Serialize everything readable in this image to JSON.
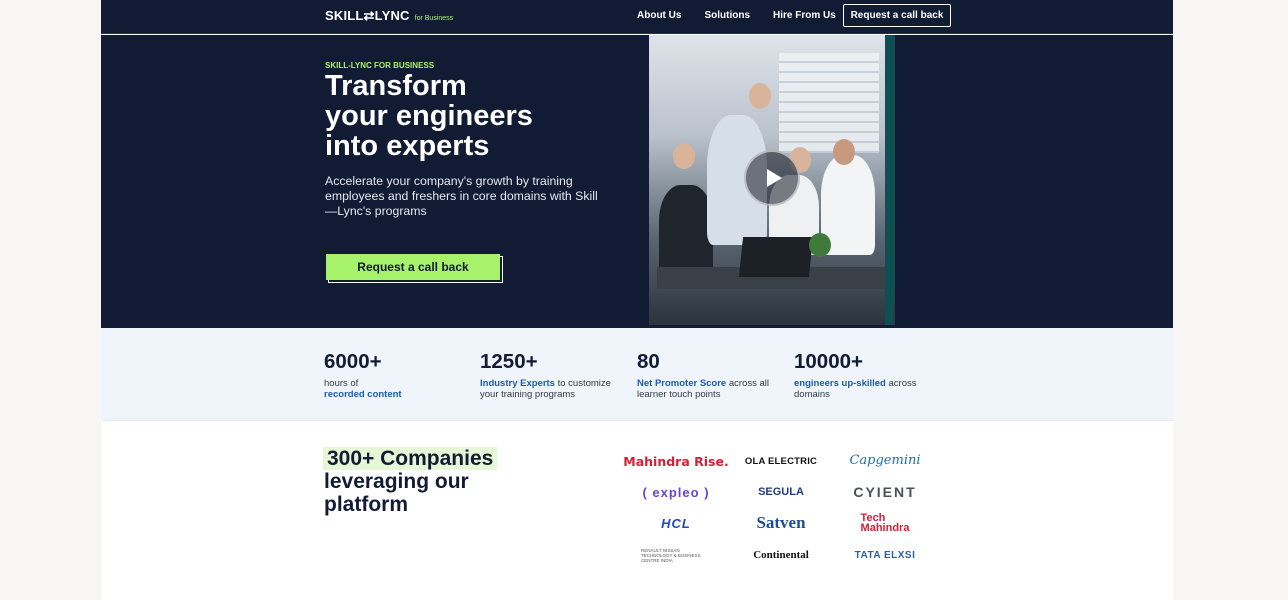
{
  "nav": {
    "logo": "SKILL⇄LYNC",
    "logo_sub": "for Business",
    "links": [
      "About Us",
      "Solutions",
      "Hire From Us"
    ],
    "cta": "Request a call back"
  },
  "hero": {
    "eyebrow": "SKILL-LYNC FOR BUSINESS",
    "headline_lines": [
      "Transform",
      "your engineers",
      "into experts"
    ],
    "subtext": "Accelerate your company's growth by training employees and freshers in core domains with Skill—Lync's programs",
    "cta": "Request a call back",
    "video": {
      "icon": "play-icon"
    }
  },
  "stats": [
    {
      "number": "6000+",
      "pre": "hours of ",
      "highlight": "recorded content",
      "post": ""
    },
    {
      "number": "1250+",
      "pre": "",
      "highlight": "Industry Experts",
      "post": " to customize your training programs"
    },
    {
      "number": "80",
      "pre": "",
      "highlight": "Net Promoter Score",
      "post": " across all learner touch points"
    },
    {
      "number": "10000+",
      "pre": "",
      "highlight": "engineers up-skilled",
      "post": " across domains"
    }
  ],
  "companies": {
    "title_chip": "300+ Companies",
    "title_rest": [
      "leveraging our",
      "platform"
    ],
    "logos": [
      "Mahindra Rise.",
      "OLA ELECTRIC",
      "Capgemini",
      "( expleo )",
      "SEGULA",
      "CYIENT",
      "HCL",
      "Satven",
      "Tech Mahindra",
      "RENAULT NISSAN TECHNOLOGY & BUSINESS CENTRE INDIA",
      "Continental",
      "TATA ELXSI"
    ]
  },
  "colors": {
    "navy": "#111b34",
    "lime": "#a6f26a",
    "link_blue": "#1d5bb5",
    "stats_bg": "#eff5fa"
  }
}
